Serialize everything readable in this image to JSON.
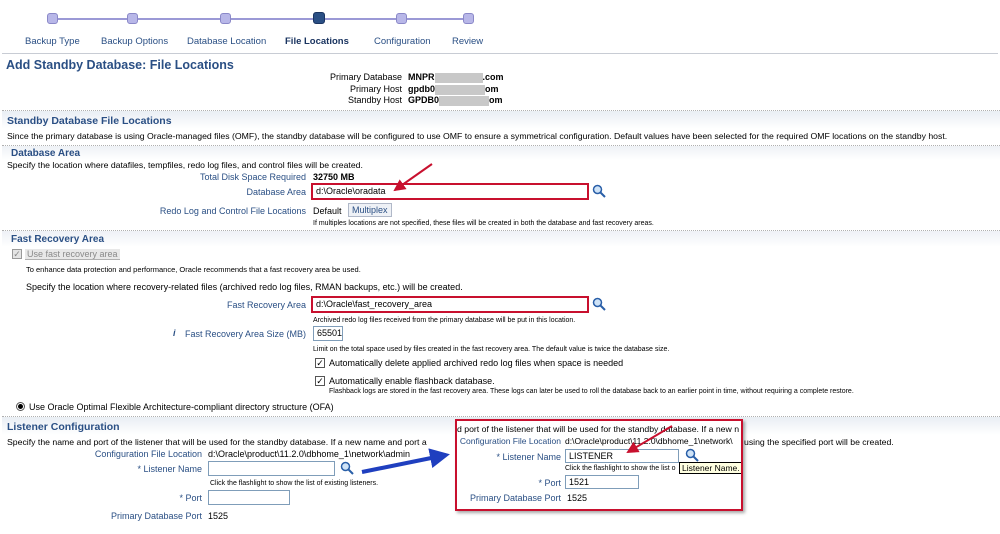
{
  "train": {
    "steps": [
      "Backup Type",
      "Backup Options",
      "Database Location",
      "File Locations",
      "Configuration",
      "Review"
    ],
    "current": 3
  },
  "page": {
    "title": "Add Standby Database: File Locations",
    "primary_database_label": "Primary Database",
    "primary_database_value": "MNPR",
    "primary_database_suffix": ".com",
    "primary_host_label": "Primary Host",
    "primary_host_value": "gpdb0",
    "primary_host_suffix": "om",
    "standby_host_label": "Standby Host",
    "standby_host_value": "GPDB0",
    "standby_host_suffix": "om"
  },
  "standby_files": {
    "heading": "Standby Database File Locations",
    "desc": "Since the primary database is using Oracle-managed files (OMF), the standby database will be configured to use OMF to ensure a symmetrical configuration. Default values have been selected for the required OMF locations on the standby host."
  },
  "db_area": {
    "heading": "Database Area",
    "desc": "Specify the location where datafiles, tempfiles, redo log files, and control files will be created.",
    "total_disk_label": "Total Disk Space Required",
    "total_disk_value": "32750 MB",
    "area_label": "Database Area",
    "area_value": "d:\\Oracle\\oradata",
    "redo_label": "Redo Log and Control File Locations",
    "redo_default": "Default",
    "redo_multiplex": "Multiplex",
    "redo_note": "If multiples locations are not specified, these files will be created in both the database and fast recovery areas."
  },
  "fra": {
    "heading": "Fast Recovery Area",
    "use_label": "Use fast recovery area",
    "recommend": "To enhance data protection and performance, Oracle recommends that a fast recovery area be used.",
    "specify": "Specify the location where recovery-related files (archived redo log files, RMAN backups, etc.) will be created.",
    "area_label": "Fast Recovery Area",
    "area_value": "d:\\Oracle\\fast_recovery_area",
    "area_note": "Archived redo log files received from the primary database will be put in this location.",
    "size_label": "Fast Recovery Area Size (MB)",
    "size_value": "65501",
    "size_note": "Limit on the total space used by files created in the fast recovery area. The default value is twice the database size.",
    "auto_delete_label": "Automatically delete applied archived redo log files when space is needed",
    "flashback_label": "Automatically enable flashback database.",
    "flashback_note": "Flashback logs are stored in the fast recovery area. These logs can later be used to roll the database back to an earlier point in time, without requiring a complete restore.",
    "ofa_label": "Use Oracle Optimal Flexible Architecture-compliant directory structure (OFA)"
  },
  "listener": {
    "heading": "Listener Configuration",
    "desc": "Specify the name and port of the listener that will be used for the standby database. If a new name and port a",
    "config_label": "Configuration File Location",
    "config_value": "d:\\Oracle\\product\\11.2.0\\dbhome_1\\network\\admin",
    "name_label": "Listener Name",
    "name_value": "",
    "name_note": "Click the flashlight to show the list of existing listeners.",
    "port_label": "Port",
    "port_value": "",
    "primary_port_label": "Primary Database Port",
    "primary_port_value": "1525",
    "required_mark": "*"
  },
  "zoom": {
    "top_text": "d port of the listener that will be used for the standby database. If a new n",
    "config_label": "Configuration File Location",
    "config_value": "d:\\Oracle\\product\\11.2.0\\dbhome_1\\network\\",
    "behind_text": "using the specified port will be created.",
    "name_label": "Listener Name",
    "name_value": "LISTENER",
    "name_note": "Click the flashlight to show the list o",
    "tooltip": "Listener Name.",
    "port_label": "Port",
    "port_value": "1521",
    "primary_port_label": "Primary Database Port",
    "primary_port_value": "1525"
  },
  "colors": {
    "accent": "#2a4f84",
    "highlight": "#c8102e",
    "arrow": "#1f3fbf",
    "train": "#b8b7e8"
  }
}
